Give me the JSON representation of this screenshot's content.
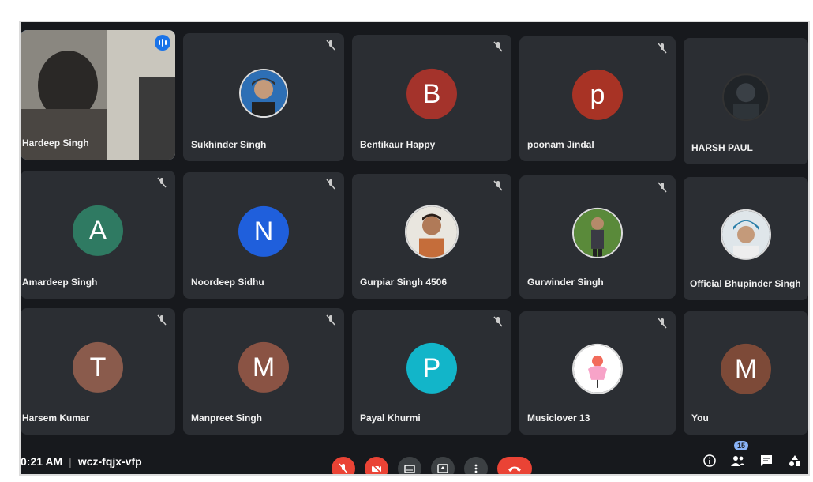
{
  "meeting": {
    "time": "0:21 AM",
    "code": "wcz-fqjx-vfp",
    "participant_count": "15"
  },
  "colors": {
    "tile_bg": "#2b2e33",
    "screen_bg": "#17191d",
    "end_call": "#ea4335",
    "speaking_blue": "#1a73e8"
  },
  "participants": [
    {
      "name": "Hardeep Singh",
      "avatar": "video",
      "active_speaker": true
    },
    {
      "name": "Sukhinder Singh",
      "avatar": "photo"
    },
    {
      "name": "Bentikaur Happy",
      "initial": "B",
      "color": "#a4332b"
    },
    {
      "name": "poonam Jindal",
      "initial": "p",
      "color": "#a83325"
    },
    {
      "name": "HARSH PAUL",
      "avatar": "photo"
    },
    {
      "name": "Amardeep Singh",
      "initial": "A",
      "color": "#2f7a62"
    },
    {
      "name": "Noordeep Sidhu",
      "initial": "N",
      "color": "#1f5fdc"
    },
    {
      "name": "Gurpiar Singh 4506",
      "avatar": "photo"
    },
    {
      "name": "Gurwinder Singh",
      "avatar": "photo"
    },
    {
      "name": "Official Bhupinder Singh",
      "avatar": "photo"
    },
    {
      "name": "Harsem Kumar",
      "initial": "T",
      "color": "#8a5b4c"
    },
    {
      "name": "Manpreet Singh",
      "initial": "M",
      "color": "#8a5344"
    },
    {
      "name": "Payal Khurmi",
      "initial": "P",
      "color": "#12b5c9"
    },
    {
      "name": "Musiclover 13",
      "avatar": "photo"
    },
    {
      "name": "You",
      "initial": "M",
      "color": "#7d4a38"
    }
  ],
  "controls": {
    "mic_icon": "mic-off-icon",
    "camera_icon": "camera-off-icon",
    "captions_icon": "captions-icon",
    "present_icon": "present-icon",
    "more_icon": "more-vert-icon",
    "end_icon": "call-end-icon"
  },
  "right_icons": {
    "info": "info-icon",
    "people": "people-icon",
    "chat": "chat-icon",
    "activities": "activities-icon"
  }
}
